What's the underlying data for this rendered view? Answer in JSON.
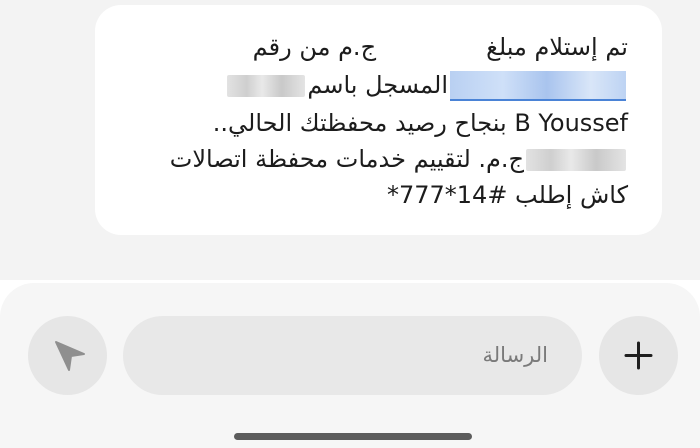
{
  "message": {
    "line1_part1": "تم إستلام مبلغ",
    "line1_part2": "ج.م من رقم",
    "line2": "المسجل باسم",
    "line3": "B Youssef بنجاح رصيد محفظتك الحالي..",
    "line4": "ج.م. لتقييم خدمات محفظة اتصالات",
    "line5": "كاش إطلب #14*777*"
  },
  "composer": {
    "placeholder": "الرسالة"
  },
  "icons": {
    "send": "send-arrow-icon",
    "add": "plus-icon"
  },
  "colors": {
    "bubble_bg": "#ffffff",
    "thread_bg": "#f3f3f3",
    "link_highlight": "#4a83d6"
  }
}
